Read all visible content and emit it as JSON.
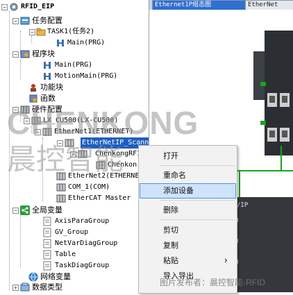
{
  "tree": {
    "root": "RFID_EIP",
    "task_config": "任务配置",
    "task1": "TASK1(任务2)",
    "main_prg_1": "Main(PRG)",
    "program_block": "程序块",
    "main_prg_2": "Main(PRG)",
    "motion_main": "MotionMain(PRG)",
    "function_block": "功能块",
    "function": "函数",
    "hw_config": "硬件配置",
    "lx_cu500": "LX_CU500(LX-CU500)",
    "ethernet1": "EtherNet1(ETHERNET)",
    "ethernetip_scanner": "EtherNetIP_Scann",
    "chenkong_rfid": "ChenkongRFI",
    "chenkong_sub": "Chenkon",
    "ethernet2": "EtherNet2(ETHERNE",
    "com1": "COM_1(COM)",
    "ethercat": "EtherCAT Master",
    "global_vars": "全局变量",
    "axis_para": "AxisParaGroup",
    "gv_group": "GV_Group",
    "netvar_diag": "NetVarDiagGroup",
    "table": "Table",
    "task_diag": "TaskDiagGroup",
    "network_vars": "网络变量",
    "data_types": "数据类型"
  },
  "tabs": {
    "active": "Ethernet1P组态图",
    "second": "EtherNet"
  },
  "canvas": {
    "module_label": "/IP"
  },
  "context_menu": {
    "open": "打开",
    "rename": "重命名",
    "add_device": "添加设备",
    "delete": "删除",
    "cut": "剪切",
    "copy": "复制",
    "paste": "粘贴",
    "paste_arrow": "›",
    "import_export": "导入导出"
  },
  "watermark": {
    "brand_en": "CHENKONG",
    "brand_cn": "晨控智能",
    "caption": "图片发布者：晨控智能-RFID"
  },
  "colors": {
    "selection": "#1f5fbf",
    "tab_active": "#2f6fd0",
    "menu_hover": "#cfe3fb",
    "link_green": "#1aa31a"
  }
}
